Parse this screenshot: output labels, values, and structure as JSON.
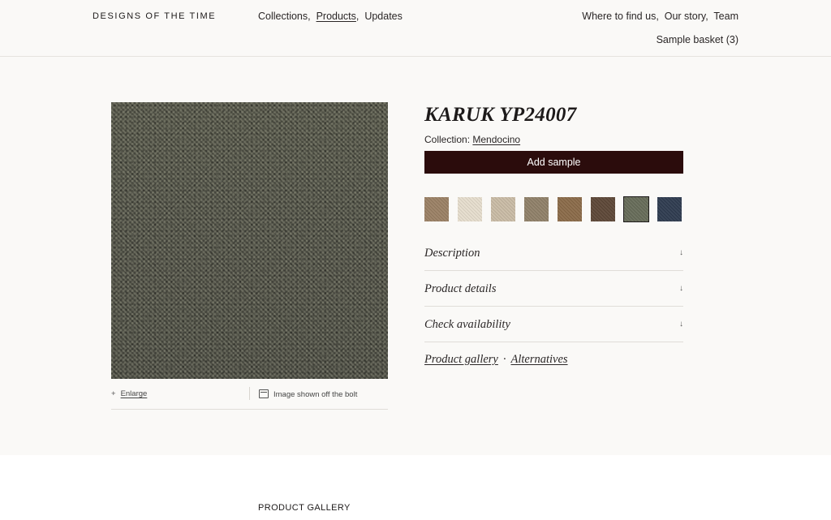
{
  "header": {
    "logo": "DESIGNS OF THE TIME",
    "nav_main": [
      "Collections",
      "Products",
      "Updates"
    ],
    "nav_right": [
      "Where to find us",
      "Our story",
      "Team"
    ],
    "basket": "Sample basket (3)"
  },
  "product": {
    "title": "KARUK YP24007",
    "collection_label": "Collection:",
    "collection_name": "Mendocino",
    "add_sample": "Add sample",
    "swatch_colors": [
      "#9a8064",
      "#e6ddcd",
      "#c9bba5",
      "#8f8068",
      "#8a6a48",
      "#5c4636",
      "#666b58",
      "#2e3b4f"
    ],
    "selected_swatch": 6
  },
  "image_caption": {
    "enlarge_icon": "+",
    "enlarge": "Enlarge",
    "bolt_text": "Image shown off the bolt"
  },
  "accordion": [
    {
      "label": "Description",
      "arrow": "↓"
    },
    {
      "label": "Product details",
      "arrow": "↓"
    },
    {
      "label": "Check availability",
      "arrow": "↓"
    }
  ],
  "links": {
    "gallery": "Product gallery",
    "separator": "·",
    "alternatives": "Alternatives"
  },
  "gallery_heading": "PRODUCT GALLERY"
}
